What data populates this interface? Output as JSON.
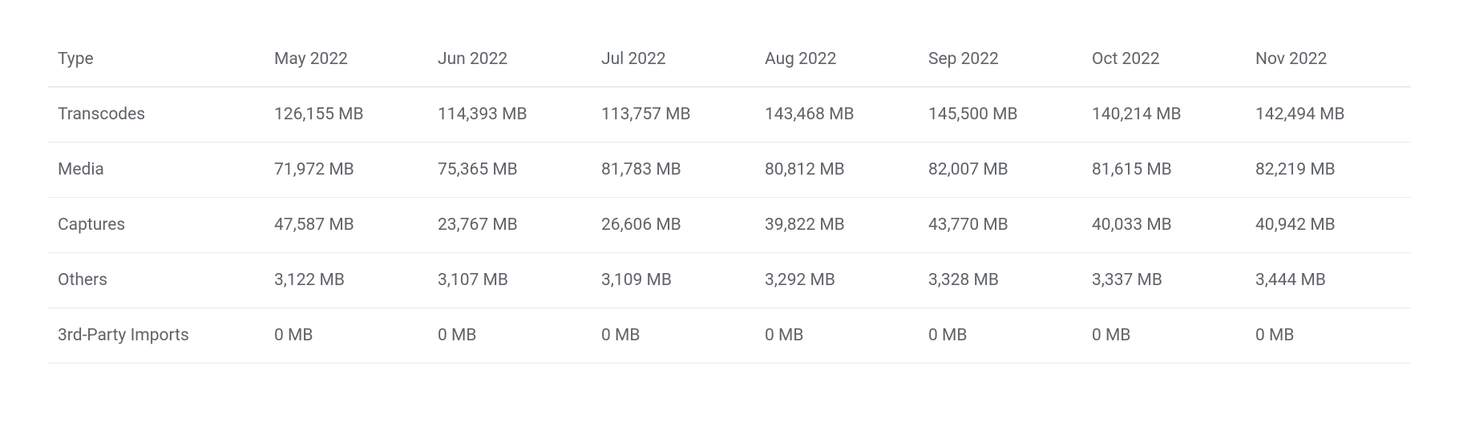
{
  "table": {
    "headers": [
      "Type",
      "May 2022",
      "Jun 2022",
      "Jul 2022",
      "Aug 2022",
      "Sep 2022",
      "Oct 2022",
      "Nov 2022"
    ],
    "rows": [
      {
        "type": "Transcodes",
        "values": [
          "126,155 MB",
          "114,393 MB",
          "113,757 MB",
          "143,468 MB",
          "145,500 MB",
          "140,214 MB",
          "142,494 MB"
        ]
      },
      {
        "type": "Media",
        "values": [
          "71,972 MB",
          "75,365 MB",
          "81,783 MB",
          "80,812 MB",
          "82,007 MB",
          "81,615 MB",
          "82,219 MB"
        ]
      },
      {
        "type": "Captures",
        "values": [
          "47,587 MB",
          "23,767 MB",
          "26,606 MB",
          "39,822 MB",
          "43,770 MB",
          "40,033 MB",
          "40,942 MB"
        ]
      },
      {
        "type": "Others",
        "values": [
          "3,122 MB",
          "3,107 MB",
          "3,109 MB",
          "3,292 MB",
          "3,328 MB",
          "3,337 MB",
          "3,444 MB"
        ]
      },
      {
        "type": "3rd-Party Imports",
        "values": [
          "0 MB",
          "0 MB",
          "0 MB",
          "0 MB",
          "0 MB",
          "0 MB",
          "0 MB"
        ]
      }
    ]
  }
}
